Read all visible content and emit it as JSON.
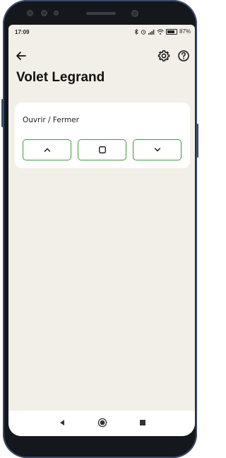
{
  "status_bar": {
    "time": "17:09",
    "battery": "87%"
  },
  "top_bar": {
    "back_icon": "arrow-left-icon",
    "settings_icon": "gear-icon",
    "help_icon": "help-circle-icon"
  },
  "page": {
    "title": "Volet Legrand"
  },
  "shutter_card": {
    "label": "Ouvrir / Fermer",
    "buttons": [
      {
        "icon": "chevron-up-icon"
      },
      {
        "icon": "stop-square-icon"
      },
      {
        "icon": "chevron-down-icon"
      }
    ]
  },
  "nav_bar": {
    "items": [
      {
        "icon": "nav-back-triangle-icon"
      },
      {
        "icon": "nav-home-circle-icon"
      },
      {
        "icon": "nav-recents-square-icon"
      }
    ]
  },
  "colors": {
    "background": "#f1efe8",
    "card": "#ffffff",
    "accent_green": "#3f9a3a",
    "text": "#111111"
  }
}
